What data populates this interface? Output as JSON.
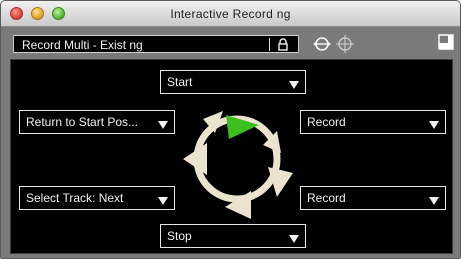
{
  "window": {
    "title": "Interactive Record ng"
  },
  "toolbar": {
    "preset_value": "Record Multi - Exist ng",
    "icons": [
      "lock-icon",
      "expand-icon",
      "target-icon",
      "panel-icon"
    ]
  },
  "controls": {
    "start": "Start",
    "stop": "Stop",
    "left_top": "Return to Start Pos...",
    "left_bottom": "Select Track: Next",
    "right_top": "Record",
    "right_bottom": "Record"
  },
  "colors": {
    "play_green": "#3bbf1f",
    "arrow_cream": "#ece3cf",
    "panel_bg": "#000000",
    "chrome_gray": "#7a7a7a"
  }
}
